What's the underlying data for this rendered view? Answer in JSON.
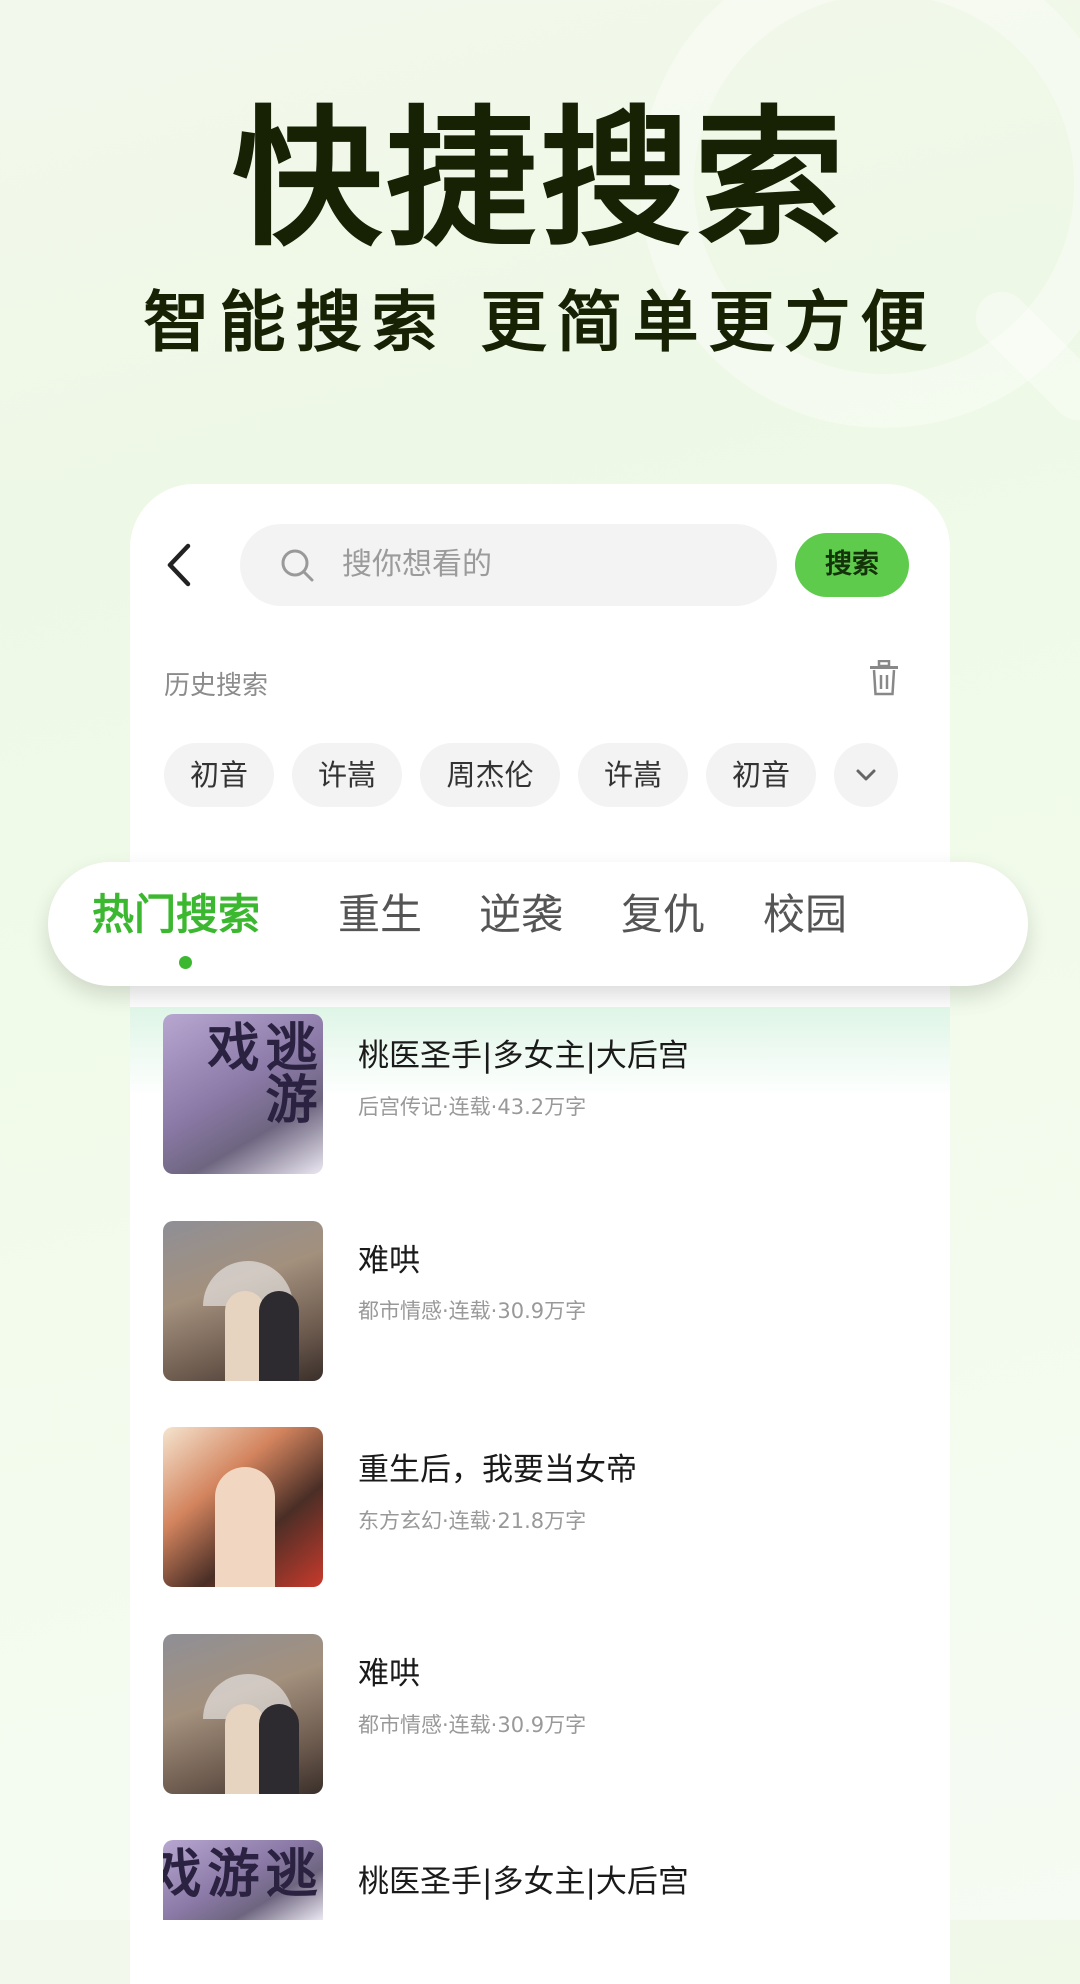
{
  "hero": {
    "title": "快捷搜索",
    "subtitle": "智能搜索 更简单更方便"
  },
  "search": {
    "placeholder": "搜你想看的",
    "button_label": "搜索"
  },
  "history": {
    "label": "历史搜索",
    "chips": [
      "初音",
      "许嵩",
      "周杰伦",
      "许嵩",
      "初音"
    ]
  },
  "tabs": [
    "热门搜索",
    "重生",
    "逆袭",
    "复仇",
    "校园"
  ],
  "active_tab": "热门搜索",
  "books": [
    {
      "title": "桃医圣手|多女主|大后宫",
      "meta": "后宫传记·连载·43.2万字",
      "cover_text": "逃游戏"
    },
    {
      "title": "难哄",
      "meta": "都市情感·连载·30.9万字"
    },
    {
      "title": "重生后，我要当女帝",
      "meta": "东方玄幻·连载·21.8万字"
    },
    {
      "title": "难哄",
      "meta": "都市情感·连载·30.9万字"
    },
    {
      "title": "桃医圣手|多女主|大后宫",
      "meta": "",
      "cover_text": "逃游戏"
    }
  ],
  "colors": {
    "accent": "#3bb830",
    "search_button": "#5ecb4c",
    "hero_text": "#172205"
  }
}
